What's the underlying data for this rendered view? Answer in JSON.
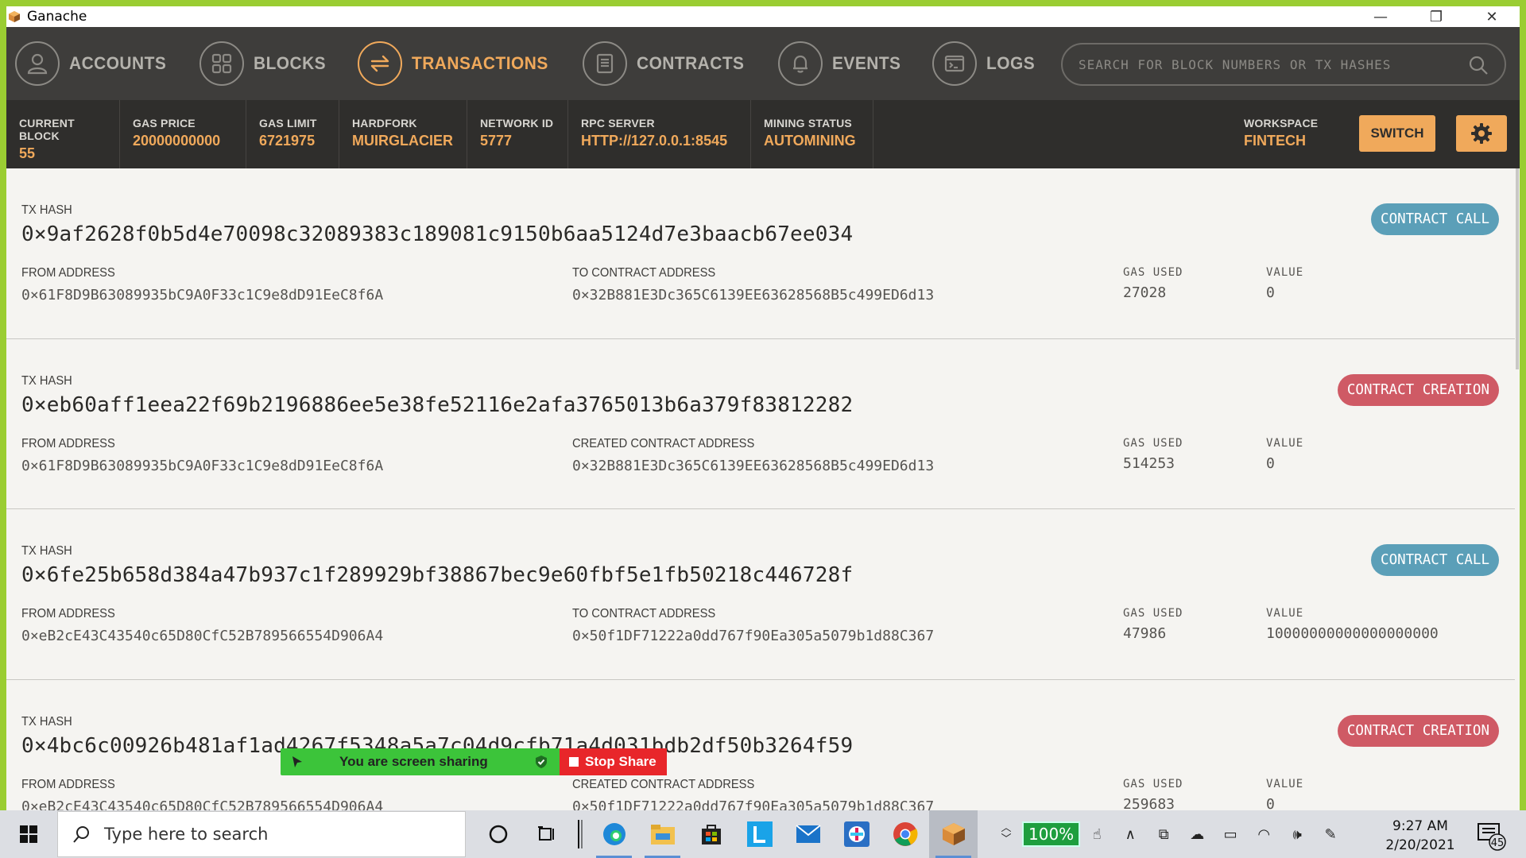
{
  "window": {
    "title": "Ganache",
    "min": "—",
    "restore": "❐",
    "close": "✕"
  },
  "nav": {
    "items": [
      {
        "label": "ACCOUNTS",
        "icon": "person-icon"
      },
      {
        "label": "BLOCKS",
        "icon": "blocks-grid-icon"
      },
      {
        "label": "TRANSACTIONS",
        "icon": "arrows-exchange-icon",
        "active": true
      },
      {
        "label": "CONTRACTS",
        "icon": "document-icon"
      },
      {
        "label": "EVENTS",
        "icon": "bell-icon"
      },
      {
        "label": "LOGS",
        "icon": "terminal-icon"
      }
    ],
    "search_placeholder": "SEARCH FOR BLOCK NUMBERS OR TX HASHES"
  },
  "status": {
    "current_block": {
      "label": "CURRENT BLOCK",
      "value": "55"
    },
    "gas_price": {
      "label": "GAS PRICE",
      "value": "20000000000"
    },
    "gas_limit": {
      "label": "GAS LIMIT",
      "value": "6721975"
    },
    "hardfork": {
      "label": "HARDFORK",
      "value": "MUIRGLACIER"
    },
    "network_id": {
      "label": "NETWORK ID",
      "value": "5777"
    },
    "rpc_server": {
      "label": "RPC SERVER",
      "value": "HTTP://127.0.0.1:8545"
    },
    "mining_status": {
      "label": "MINING STATUS",
      "value": "AUTOMINING"
    },
    "workspace": {
      "label": "WORKSPACE",
      "value": "FINTECH"
    },
    "switch_label": "SWITCH"
  },
  "labels": {
    "tx_hash": "TX HASH",
    "from_address": "FROM ADDRESS",
    "gas_used": "GAS USED",
    "value": "VALUE"
  },
  "transactions": [
    {
      "hash": "0×9af2628f0b5d4e70098c32089383c189081c9150b6aa5124d7e3baacb67ee034",
      "type": "CONTRACT CALL",
      "from": "0×61F8D9B63089935bC9A0F33c1C9e8dD91EeC8f6A",
      "to_label": "TO CONTRACT ADDRESS",
      "to": "0×32B881E3Dc365C6139EE63628568B5c499ED6d13",
      "gas_used": "27028",
      "value": "0"
    },
    {
      "hash": "0×eb60aff1eea22f69b2196886ee5e38fe52116e2afa3765013b6a379f83812282",
      "type": "CONTRACT CREATION",
      "from": "0×61F8D9B63089935bC9A0F33c1C9e8dD91EeC8f6A",
      "to_label": "CREATED CONTRACT ADDRESS",
      "to": "0×32B881E3Dc365C6139EE63628568B5c499ED6d13",
      "gas_used": "514253",
      "value": "0"
    },
    {
      "hash": "0×6fe25b658d384a47b937c1f289929bf38867bec9e60fbf5e1fb50218c446728f",
      "type": "CONTRACT CALL",
      "from": "0×eB2cE43C43540c65D80CfC52B789566554D906A4",
      "to_label": "TO CONTRACT ADDRESS",
      "to": "0×50f1DF71222a0dd767f90Ea305a5079b1d88C367",
      "gas_used": "47986",
      "value": "10000000000000000000"
    },
    {
      "hash": "0×4bc6c00926b481af1ad4267f5348a5a7c04d9cfb71a4d031bdb2df50b3264f59",
      "type": "CONTRACT CREATION",
      "from": "0×eB2cE43C43540c65D80CfC52B789566554D906A4",
      "to_label": "CREATED CONTRACT ADDRESS",
      "to": "0×50f1DF71222a0dd767f90Ea305a5079b1d88C367",
      "gas_used": "259683",
      "value": "0"
    }
  ],
  "screen_share": {
    "text": "You are screen sharing",
    "stop": "Stop Share"
  },
  "taskbar": {
    "search_placeholder": "Type here to search",
    "zoom": "100%",
    "time": "9:27 AM",
    "date": "2/20/2021",
    "notifications": "45"
  },
  "colors": {
    "accent": "#f0a95b",
    "call": "#5b9fb8",
    "creation": "#cf5a65",
    "nav_bg": "#3e3d3b",
    "status_bg": "#2f2e2c",
    "frame": "#9acd32"
  }
}
